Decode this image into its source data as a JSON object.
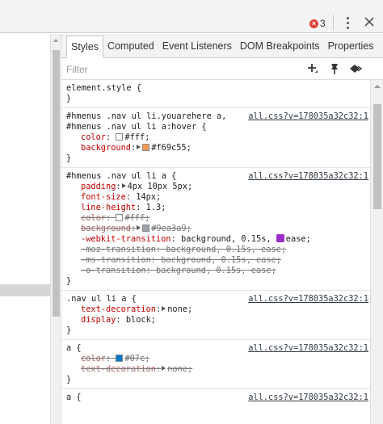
{
  "toolbar": {
    "error_count": "3",
    "error_icon": "error-circle-icon",
    "more_icon": "kebab-menu-icon",
    "close_icon": "close-icon"
  },
  "tabs": [
    {
      "label": "Styles",
      "active": true
    },
    {
      "label": "Computed"
    },
    {
      "label": "Event Listeners"
    },
    {
      "label": "DOM Breakpoints"
    },
    {
      "label": "Properties"
    }
  ],
  "filter": {
    "placeholder": "Filter",
    "icons": [
      "new-style-rule-icon",
      "pin-element-state-icon",
      "toggle-classes-icon"
    ]
  },
  "rules": {
    "r0": {
      "selector": "element.style {",
      "close": "}"
    },
    "r1": {
      "selector1": "#hmenus .nav ul li.youarehere a,",
      "selector2": "#hmenus .nav ul li a:hover {",
      "source": "all.css?v=178035a32c32:1",
      "props": [
        {
          "name": "color",
          "value": "#fff;",
          "swatch": "#ffffff"
        },
        {
          "name": "background",
          "value": "#f69c55;",
          "swatch": "#f69c55"
        }
      ],
      "close": "}"
    },
    "r2": {
      "selector": "#hmenus .nav ul li a {",
      "source": "all.css?v=178035a32c32:1",
      "p0": {
        "name": "padding",
        "value": "4px 10px 5px;"
      },
      "p1": {
        "name": "font-size",
        "value": "14px;"
      },
      "p2": {
        "name": "line-height",
        "value": "1.3;"
      },
      "p3": {
        "name": "color",
        "value": "#fff;",
        "swatch": "#ffffff"
      },
      "p4": {
        "name": "background",
        "value": "#9ea3a9;",
        "swatch": "#9ea3a9"
      },
      "p5": {
        "name": "-webkit-transition",
        "value1": "background, 0.15s,",
        "value2": "ease;"
      },
      "p6": {
        "text": "-moz-transition: background, 0.15s, ease;"
      },
      "p7": {
        "text": "-ms-transition: background, 0.15s, ease;"
      },
      "p8": {
        "text": "-o-transition: background, 0.15s, ease;"
      },
      "close": "}"
    },
    "r3": {
      "selector": ".nav ul li a {",
      "source": "all.css?v=178035a32c32:1",
      "p0": {
        "name": "text-decoration",
        "value": "none;"
      },
      "p1": {
        "name": "display",
        "value": "block;"
      },
      "close": "}"
    },
    "r4": {
      "selector": "a {",
      "source": "all.css?v=178035a32c32:1",
      "p0": {
        "name": "color",
        "value": "#07c;",
        "swatch": "#0077cc"
      },
      "p1": {
        "name": "text-decoration",
        "value": "none;"
      },
      "close": "}"
    },
    "r5": {
      "selector": "a {",
      "source": "all.css?v=178035a32c32:1"
    }
  },
  "colors": {
    "prop_name": "#c80000",
    "accent_error": "#e0403a"
  }
}
